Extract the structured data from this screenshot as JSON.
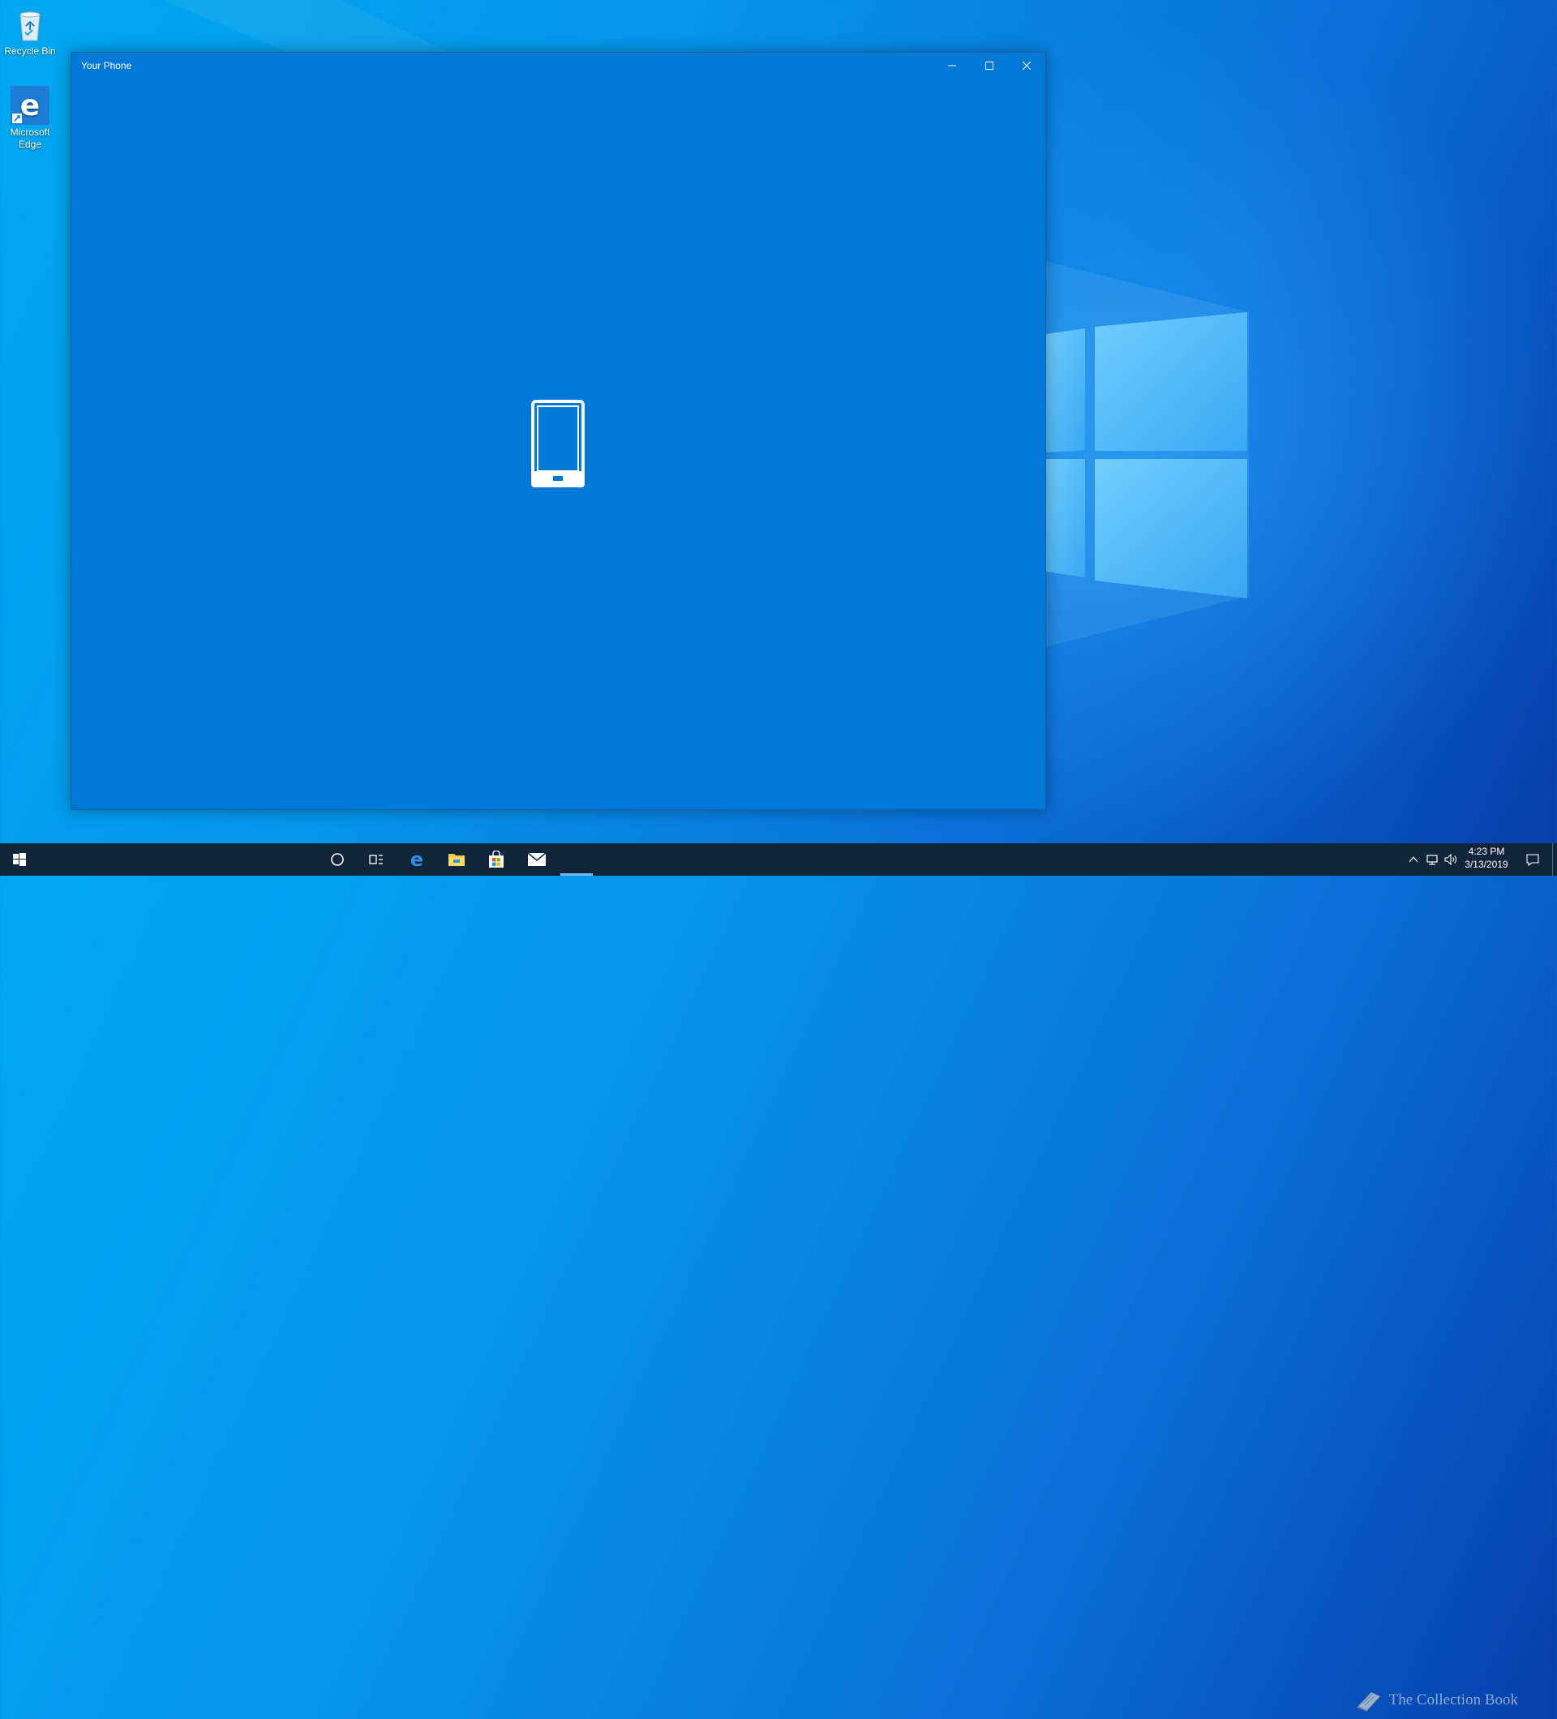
{
  "desktop": {
    "icons": [
      {
        "label": "Recycle Bin",
        "icon": "recycle-bin-icon"
      },
      {
        "label": "Microsoft Edge",
        "icon": "edge-icon"
      }
    ]
  },
  "window": {
    "title": "Your Phone",
    "hero_icon": "phone-icon",
    "accent": "#0078d7"
  },
  "taskbar": {
    "items": [
      "start-icon",
      "search-icon",
      "task-view-icon",
      "edge-icon",
      "file-explorer-icon",
      "store-icon",
      "mail-icon"
    ],
    "clock": {
      "time": "4:23 PM",
      "date": "3/13/2019"
    },
    "watermark": "The Collection Book"
  }
}
